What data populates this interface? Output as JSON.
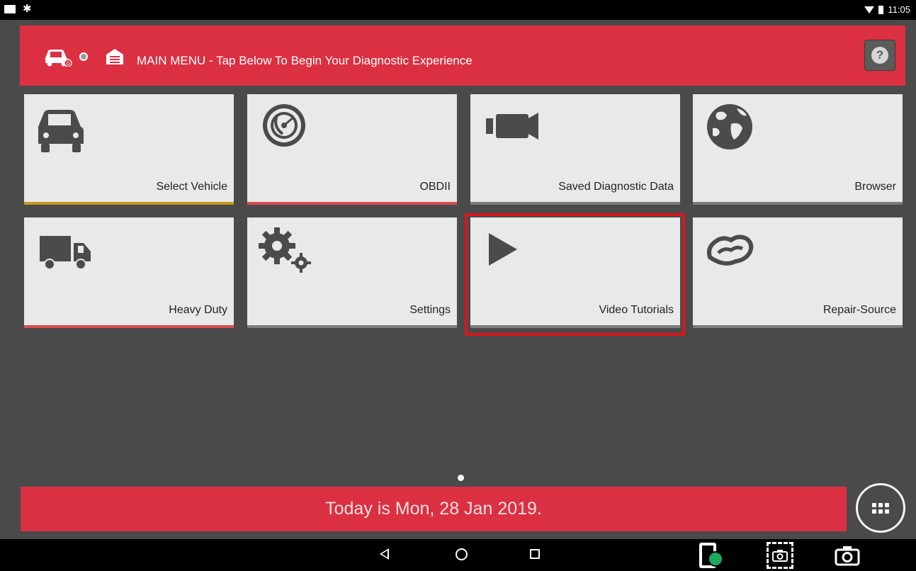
{
  "status_bar": {
    "time": "11:05"
  },
  "header": {
    "title": "MAIN MENU - Tap Below To Begin Your Diagnostic Experience",
    "icons": [
      "car-icon",
      "status-dot-icon",
      "garage-icon"
    ],
    "help_icon": "help-icon",
    "help_label": "?"
  },
  "tiles": [
    {
      "label": "Select Vehicle",
      "icon": "car-icon",
      "accent": "#c8961e"
    },
    {
      "label": "OBDII",
      "icon": "radar-icon",
      "accent": "#d94c52"
    },
    {
      "label": "Saved Diagnostic Data",
      "icon": "video-camera-icon",
      "accent": "#7c7c7c"
    },
    {
      "label": "Browser",
      "icon": "globe-icon",
      "accent": "#7c7c7c"
    },
    {
      "label": "Heavy Duty",
      "icon": "truck-icon",
      "accent": "#d94c52"
    },
    {
      "label": "Settings",
      "icon": "gears-icon",
      "accent": "#7c7c7c"
    },
    {
      "label": "Video Tutorials",
      "icon": "play-icon",
      "accent": "#7c7c7c",
      "selected": true
    },
    {
      "label": "Repair-Source",
      "icon": "repair-source-icon",
      "accent": "#7c7c7c"
    }
  ],
  "footer": {
    "date_text": "Today is Mon, 28 Jan 2019."
  },
  "colors": {
    "brand_red": "#db3042",
    "background": "#4a4a4a",
    "selection": "#d8161c"
  }
}
